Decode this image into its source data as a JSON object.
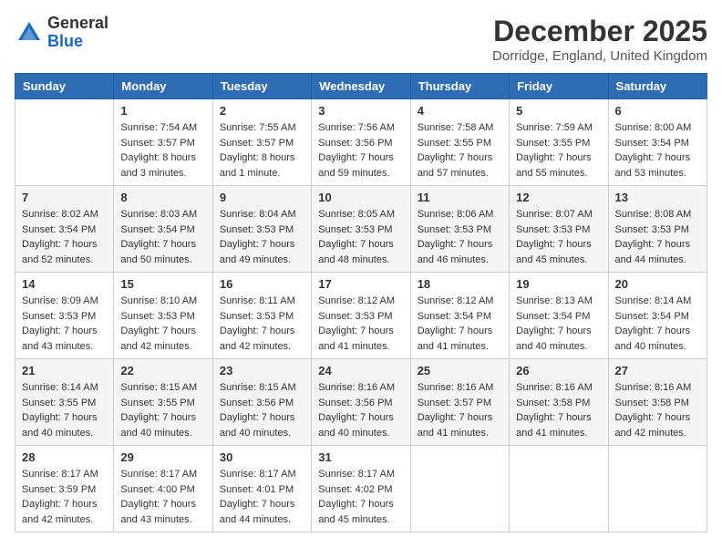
{
  "header": {
    "logo_general": "General",
    "logo_blue": "Blue",
    "month_title": "December 2025",
    "location": "Dorridge, England, United Kingdom"
  },
  "weekdays": [
    "Sunday",
    "Monday",
    "Tuesday",
    "Wednesday",
    "Thursday",
    "Friday",
    "Saturday"
  ],
  "weeks": [
    [
      {
        "day": "",
        "info": ""
      },
      {
        "day": "1",
        "info": "Sunrise: 7:54 AM\nSunset: 3:57 PM\nDaylight: 8 hours\nand 3 minutes."
      },
      {
        "day": "2",
        "info": "Sunrise: 7:55 AM\nSunset: 3:57 PM\nDaylight: 8 hours\nand 1 minute."
      },
      {
        "day": "3",
        "info": "Sunrise: 7:56 AM\nSunset: 3:56 PM\nDaylight: 7 hours\nand 59 minutes."
      },
      {
        "day": "4",
        "info": "Sunrise: 7:58 AM\nSunset: 3:55 PM\nDaylight: 7 hours\nand 57 minutes."
      },
      {
        "day": "5",
        "info": "Sunrise: 7:59 AM\nSunset: 3:55 PM\nDaylight: 7 hours\nand 55 minutes."
      },
      {
        "day": "6",
        "info": "Sunrise: 8:00 AM\nSunset: 3:54 PM\nDaylight: 7 hours\nand 53 minutes."
      }
    ],
    [
      {
        "day": "7",
        "info": "Sunrise: 8:02 AM\nSunset: 3:54 PM\nDaylight: 7 hours\nand 52 minutes."
      },
      {
        "day": "8",
        "info": "Sunrise: 8:03 AM\nSunset: 3:54 PM\nDaylight: 7 hours\nand 50 minutes."
      },
      {
        "day": "9",
        "info": "Sunrise: 8:04 AM\nSunset: 3:53 PM\nDaylight: 7 hours\nand 49 minutes."
      },
      {
        "day": "10",
        "info": "Sunrise: 8:05 AM\nSunset: 3:53 PM\nDaylight: 7 hours\nand 48 minutes."
      },
      {
        "day": "11",
        "info": "Sunrise: 8:06 AM\nSunset: 3:53 PM\nDaylight: 7 hours\nand 46 minutes."
      },
      {
        "day": "12",
        "info": "Sunrise: 8:07 AM\nSunset: 3:53 PM\nDaylight: 7 hours\nand 45 minutes."
      },
      {
        "day": "13",
        "info": "Sunrise: 8:08 AM\nSunset: 3:53 PM\nDaylight: 7 hours\nand 44 minutes."
      }
    ],
    [
      {
        "day": "14",
        "info": "Sunrise: 8:09 AM\nSunset: 3:53 PM\nDaylight: 7 hours\nand 43 minutes."
      },
      {
        "day": "15",
        "info": "Sunrise: 8:10 AM\nSunset: 3:53 PM\nDaylight: 7 hours\nand 42 minutes."
      },
      {
        "day": "16",
        "info": "Sunrise: 8:11 AM\nSunset: 3:53 PM\nDaylight: 7 hours\nand 42 minutes."
      },
      {
        "day": "17",
        "info": "Sunrise: 8:12 AM\nSunset: 3:53 PM\nDaylight: 7 hours\nand 41 minutes."
      },
      {
        "day": "18",
        "info": "Sunrise: 8:12 AM\nSunset: 3:54 PM\nDaylight: 7 hours\nand 41 minutes."
      },
      {
        "day": "19",
        "info": "Sunrise: 8:13 AM\nSunset: 3:54 PM\nDaylight: 7 hours\nand 40 minutes."
      },
      {
        "day": "20",
        "info": "Sunrise: 8:14 AM\nSunset: 3:54 PM\nDaylight: 7 hours\nand 40 minutes."
      }
    ],
    [
      {
        "day": "21",
        "info": "Sunrise: 8:14 AM\nSunset: 3:55 PM\nDaylight: 7 hours\nand 40 minutes."
      },
      {
        "day": "22",
        "info": "Sunrise: 8:15 AM\nSunset: 3:55 PM\nDaylight: 7 hours\nand 40 minutes."
      },
      {
        "day": "23",
        "info": "Sunrise: 8:15 AM\nSunset: 3:56 PM\nDaylight: 7 hours\nand 40 minutes."
      },
      {
        "day": "24",
        "info": "Sunrise: 8:16 AM\nSunset: 3:56 PM\nDaylight: 7 hours\nand 40 minutes."
      },
      {
        "day": "25",
        "info": "Sunrise: 8:16 AM\nSunset: 3:57 PM\nDaylight: 7 hours\nand 41 minutes."
      },
      {
        "day": "26",
        "info": "Sunrise: 8:16 AM\nSunset: 3:58 PM\nDaylight: 7 hours\nand 41 minutes."
      },
      {
        "day": "27",
        "info": "Sunrise: 8:16 AM\nSunset: 3:58 PM\nDaylight: 7 hours\nand 42 minutes."
      }
    ],
    [
      {
        "day": "28",
        "info": "Sunrise: 8:17 AM\nSunset: 3:59 PM\nDaylight: 7 hours\nand 42 minutes."
      },
      {
        "day": "29",
        "info": "Sunrise: 8:17 AM\nSunset: 4:00 PM\nDaylight: 7 hours\nand 43 minutes."
      },
      {
        "day": "30",
        "info": "Sunrise: 8:17 AM\nSunset: 4:01 PM\nDaylight: 7 hours\nand 44 minutes."
      },
      {
        "day": "31",
        "info": "Sunrise: 8:17 AM\nSunset: 4:02 PM\nDaylight: 7 hours\nand 45 minutes."
      },
      {
        "day": "",
        "info": ""
      },
      {
        "day": "",
        "info": ""
      },
      {
        "day": "",
        "info": ""
      }
    ]
  ]
}
